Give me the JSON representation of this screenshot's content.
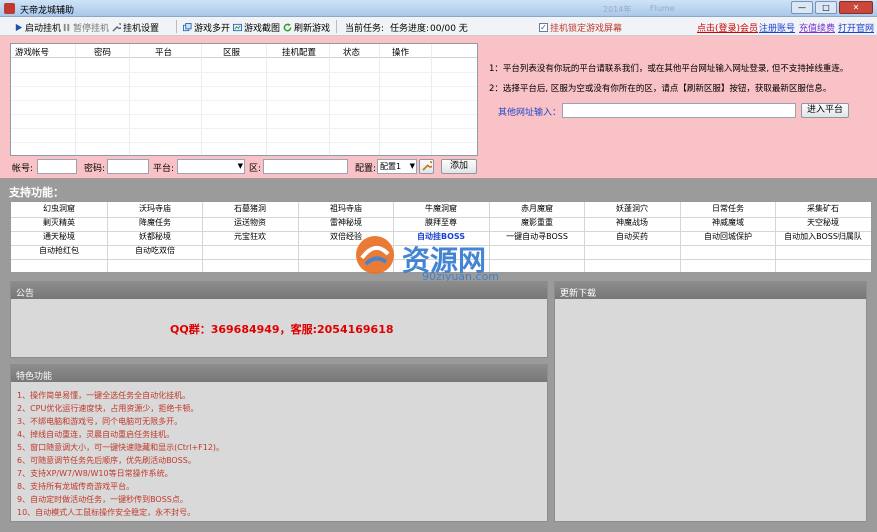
{
  "window": {
    "title": "天帝龙城辅助",
    "ghost": [
      "2014年",
      "Flume"
    ],
    "controls": [
      "—",
      "□",
      "✕"
    ]
  },
  "toolbar": {
    "start": "启动挂机",
    "pause": "暂停挂机",
    "settings": "挂机设置",
    "multi": "游戏多开",
    "cut": "游戏截图",
    "refresh": "刷新游戏",
    "task_label": "当前任务:",
    "progress_label": "任务进度:",
    "progress_value": "00/00 无",
    "lock_label": "挂机锁定游戏屏幕",
    "login": "点击(登录)会员",
    "register": "注册账号",
    "recharge": "充值续费",
    "home": "打开官网",
    "colors": {
      "login": "#d10000",
      "register": "#1a3fd1",
      "recharge": "#7b2fd1",
      "home": "#1a3fd1"
    }
  },
  "grid": {
    "headers": [
      "游戏帐号",
      "密码",
      "平台",
      "区服",
      "挂机配置",
      "状态",
      "操作"
    ]
  },
  "form": {
    "account": "帐号:",
    "password": "密码:",
    "platform": "平台:",
    "zone": "区:",
    "config": "配置:",
    "config_value": "配置1",
    "add": "添加"
  },
  "notes": [
    "1：平台列表没有你玩的平台请联系我们，或在其他平台网址输入网址登录, 但不支持掉线重连。",
    "2：选择平台后, 区服为空或没有你所在的区，请点【刷新区服】按钮，获取最新区服信息。"
  ],
  "other": {
    "label": "其他网址输入：",
    "button": "进入平台"
  },
  "features": {
    "title": "支持功能：",
    "rows": [
      [
        "幻虫洞窟",
        "沃玛寺庙",
        "石墓猪洞",
        "祖玛寺庙",
        "牛魔洞窟",
        "赤月魔窟",
        "妖蓬洞穴",
        "日常任务",
        "采集矿石"
      ],
      [
        "剿灭精英",
        "降魔任务",
        "运送物资",
        "雷神秘境",
        "膜拜至尊",
        "魔影重重",
        "神魔战场",
        "神威魔域",
        "天空秘境"
      ],
      [
        "通天秘境",
        "妖都秘境",
        "元宝狂欢",
        "双倍经验",
        "自动挂BOSS",
        "一键自动寻BOSS",
        "自动买药",
        "自动回城保护",
        "自动加入BOSS归属队"
      ],
      [
        "自动抢红包",
        "自动吃双倍",
        "",
        "",
        "",
        "",
        "",
        "",
        ""
      ],
      [
        "",
        "",
        "",
        "",
        "",
        "",
        "",
        "",
        ""
      ]
    ],
    "highlight": "自动挂BOSS"
  },
  "notice": {
    "title": "公告",
    "qq": "QQ群：369684949，客服:2054169618"
  },
  "download": {
    "title": "更新下载"
  },
  "specials": {
    "title": "特色功能",
    "items": [
      "1、操作简单易懂，一键全选任务全自动化挂机。",
      "2、CPU优化运行速度快，占用资源少，拒绝卡顿。",
      "3、不绑电脑和游戏号，同个电脑可无限多开。",
      "4、掉线自动重连，灵晨自动重启任务挂机。",
      "5、窗口随意调大小，可一键快速隐藏和显示(Ctrl+F12)。",
      "6、可随意调节任务先后顺序，优先刷活动BOSS。",
      "7、支持XP/W7/W8/W10等日常操作系统。",
      "8、支持所有龙城传奇游戏平台。",
      "9、自动定时做活动任务，一键秒传到BOSS点。",
      "10、自动模式人工鼠标操作安全稳定，永不封号。"
    ]
  },
  "watermark": {
    "text": "资源网",
    "url": "90ziyuan.com"
  }
}
